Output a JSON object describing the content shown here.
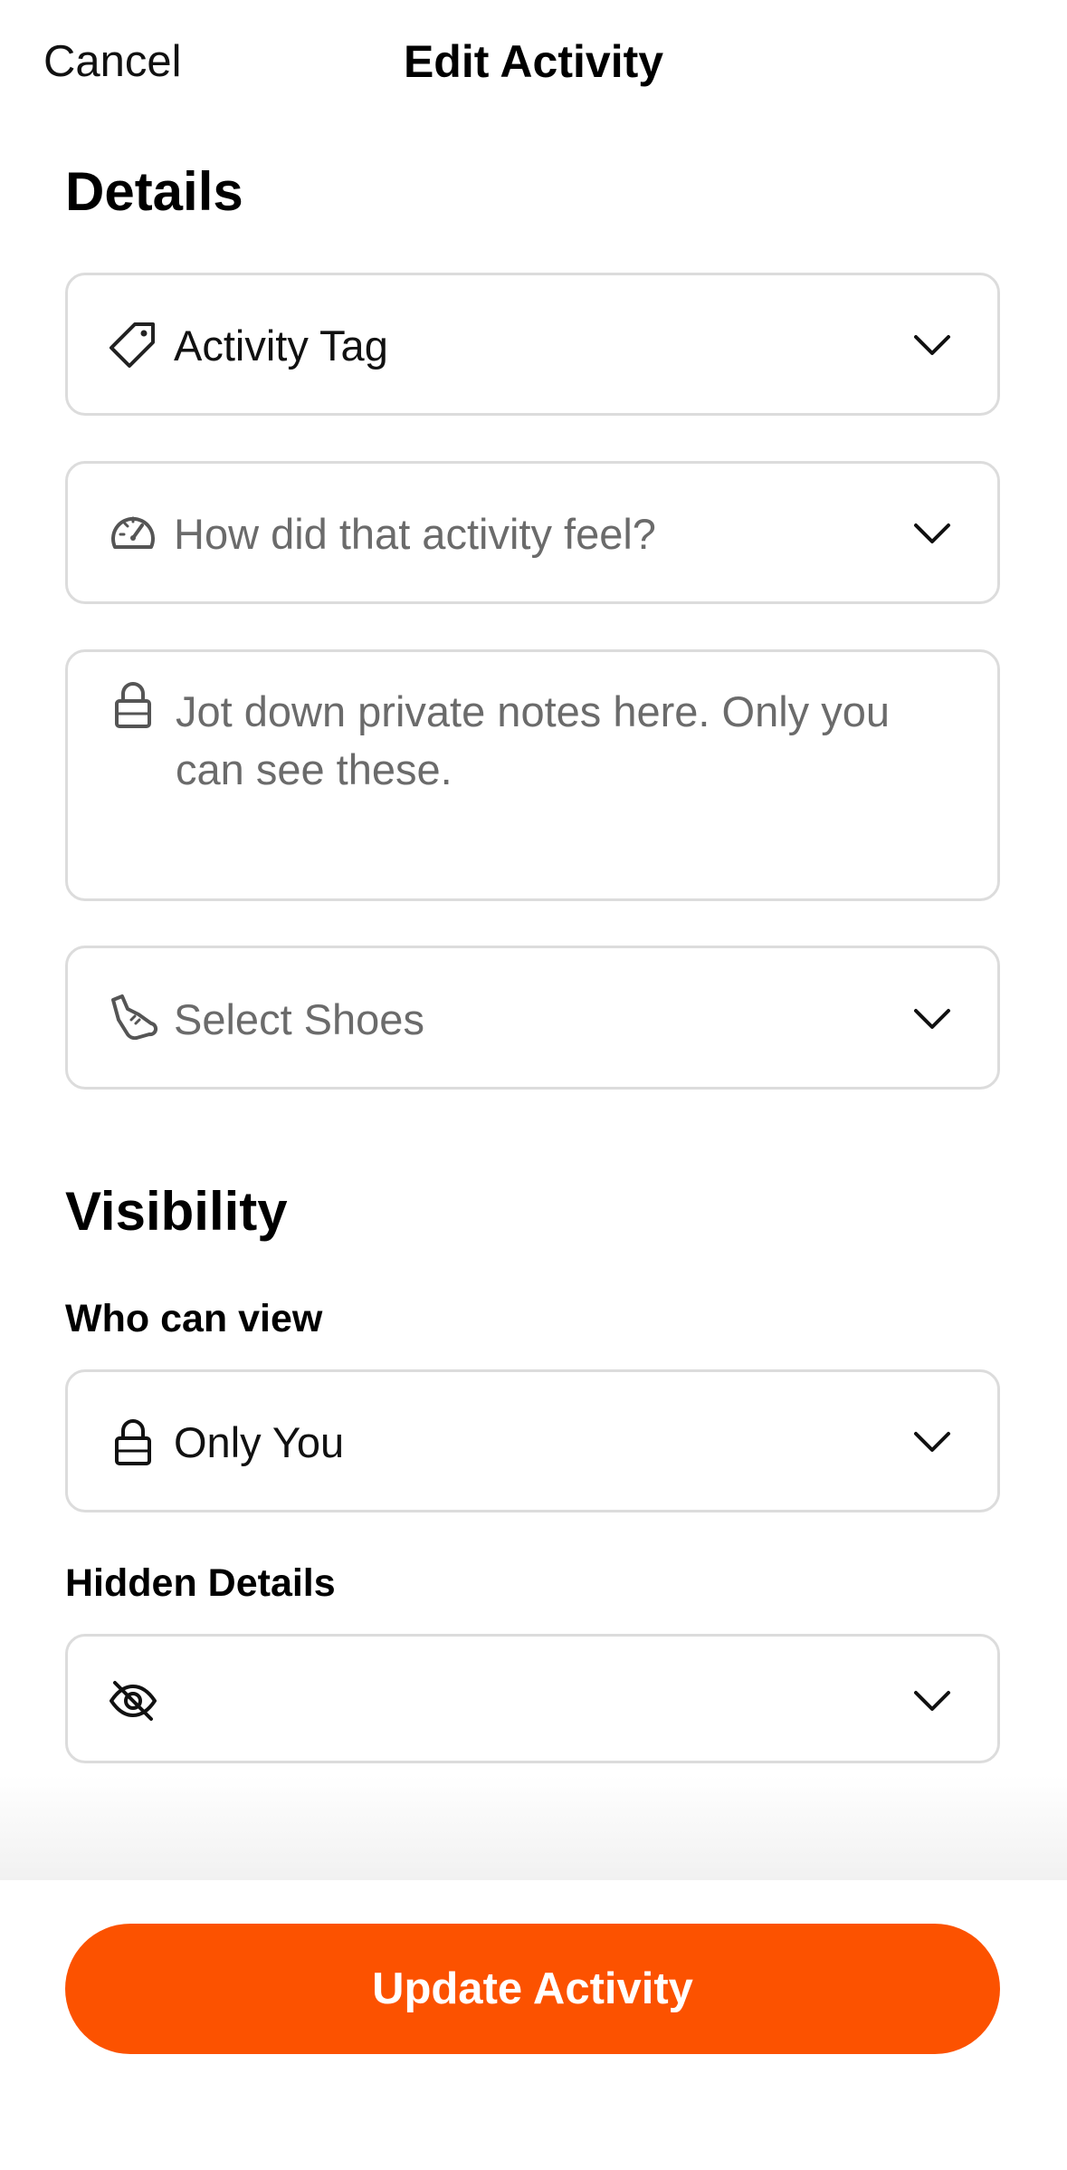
{
  "header": {
    "cancel_label": "Cancel",
    "title": "Edit Activity"
  },
  "details": {
    "section_title": "Details",
    "activity_tag": {
      "icon": "tag-icon",
      "value": "Activity Tag"
    },
    "perceived_exertion": {
      "icon": "speedometer-icon",
      "placeholder": "How did that activity feel?"
    },
    "private_notes": {
      "icon": "lock-icon",
      "placeholder": "Jot down private notes here. Only you can see these."
    },
    "shoes": {
      "icon": "shoe-icon",
      "placeholder": "Select Shoes"
    }
  },
  "visibility": {
    "section_title": "Visibility",
    "who_can_view": {
      "label": "Who can view",
      "icon": "lock-icon",
      "value": "Only You"
    },
    "hidden_details": {
      "label": "Hidden Details",
      "icon": "eye-slash-icon",
      "value": ""
    }
  },
  "footer": {
    "update_label": "Update Activity"
  },
  "colors": {
    "accent": "#fc5200",
    "border": "#dcdcdc",
    "placeholder_text": "#6b6b6b"
  }
}
